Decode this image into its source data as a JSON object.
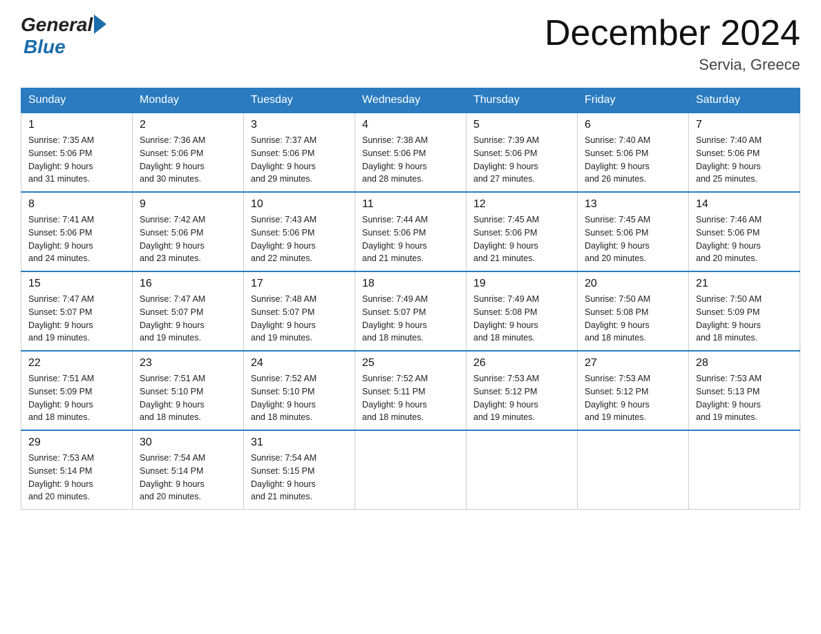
{
  "header": {
    "logo_general": "General",
    "logo_blue": "Blue",
    "month_title": "December 2024",
    "location": "Servia, Greece"
  },
  "days_of_week": [
    "Sunday",
    "Monday",
    "Tuesday",
    "Wednesday",
    "Thursday",
    "Friday",
    "Saturday"
  ],
  "weeks": [
    [
      {
        "day": "1",
        "sunrise": "7:35 AM",
        "sunset": "5:06 PM",
        "daylight": "9 hours and 31 minutes."
      },
      {
        "day": "2",
        "sunrise": "7:36 AM",
        "sunset": "5:06 PM",
        "daylight": "9 hours and 30 minutes."
      },
      {
        "day": "3",
        "sunrise": "7:37 AM",
        "sunset": "5:06 PM",
        "daylight": "9 hours and 29 minutes."
      },
      {
        "day": "4",
        "sunrise": "7:38 AM",
        "sunset": "5:06 PM",
        "daylight": "9 hours and 28 minutes."
      },
      {
        "day": "5",
        "sunrise": "7:39 AM",
        "sunset": "5:06 PM",
        "daylight": "9 hours and 27 minutes."
      },
      {
        "day": "6",
        "sunrise": "7:40 AM",
        "sunset": "5:06 PM",
        "daylight": "9 hours and 26 minutes."
      },
      {
        "day": "7",
        "sunrise": "7:40 AM",
        "sunset": "5:06 PM",
        "daylight": "9 hours and 25 minutes."
      }
    ],
    [
      {
        "day": "8",
        "sunrise": "7:41 AM",
        "sunset": "5:06 PM",
        "daylight": "9 hours and 24 minutes."
      },
      {
        "day": "9",
        "sunrise": "7:42 AM",
        "sunset": "5:06 PM",
        "daylight": "9 hours and 23 minutes."
      },
      {
        "day": "10",
        "sunrise": "7:43 AM",
        "sunset": "5:06 PM",
        "daylight": "9 hours and 22 minutes."
      },
      {
        "day": "11",
        "sunrise": "7:44 AM",
        "sunset": "5:06 PM",
        "daylight": "9 hours and 21 minutes."
      },
      {
        "day": "12",
        "sunrise": "7:45 AM",
        "sunset": "5:06 PM",
        "daylight": "9 hours and 21 minutes."
      },
      {
        "day": "13",
        "sunrise": "7:45 AM",
        "sunset": "5:06 PM",
        "daylight": "9 hours and 20 minutes."
      },
      {
        "day": "14",
        "sunrise": "7:46 AM",
        "sunset": "5:06 PM",
        "daylight": "9 hours and 20 minutes."
      }
    ],
    [
      {
        "day": "15",
        "sunrise": "7:47 AM",
        "sunset": "5:07 PM",
        "daylight": "9 hours and 19 minutes."
      },
      {
        "day": "16",
        "sunrise": "7:47 AM",
        "sunset": "5:07 PM",
        "daylight": "9 hours and 19 minutes."
      },
      {
        "day": "17",
        "sunrise": "7:48 AM",
        "sunset": "5:07 PM",
        "daylight": "9 hours and 19 minutes."
      },
      {
        "day": "18",
        "sunrise": "7:49 AM",
        "sunset": "5:07 PM",
        "daylight": "9 hours and 18 minutes."
      },
      {
        "day": "19",
        "sunrise": "7:49 AM",
        "sunset": "5:08 PM",
        "daylight": "9 hours and 18 minutes."
      },
      {
        "day": "20",
        "sunrise": "7:50 AM",
        "sunset": "5:08 PM",
        "daylight": "9 hours and 18 minutes."
      },
      {
        "day": "21",
        "sunrise": "7:50 AM",
        "sunset": "5:09 PM",
        "daylight": "9 hours and 18 minutes."
      }
    ],
    [
      {
        "day": "22",
        "sunrise": "7:51 AM",
        "sunset": "5:09 PM",
        "daylight": "9 hours and 18 minutes."
      },
      {
        "day": "23",
        "sunrise": "7:51 AM",
        "sunset": "5:10 PM",
        "daylight": "9 hours and 18 minutes."
      },
      {
        "day": "24",
        "sunrise": "7:52 AM",
        "sunset": "5:10 PM",
        "daylight": "9 hours and 18 minutes."
      },
      {
        "day": "25",
        "sunrise": "7:52 AM",
        "sunset": "5:11 PM",
        "daylight": "9 hours and 18 minutes."
      },
      {
        "day": "26",
        "sunrise": "7:53 AM",
        "sunset": "5:12 PM",
        "daylight": "9 hours and 19 minutes."
      },
      {
        "day": "27",
        "sunrise": "7:53 AM",
        "sunset": "5:12 PM",
        "daylight": "9 hours and 19 minutes."
      },
      {
        "day": "28",
        "sunrise": "7:53 AM",
        "sunset": "5:13 PM",
        "daylight": "9 hours and 19 minutes."
      }
    ],
    [
      {
        "day": "29",
        "sunrise": "7:53 AM",
        "sunset": "5:14 PM",
        "daylight": "9 hours and 20 minutes."
      },
      {
        "day": "30",
        "sunrise": "7:54 AM",
        "sunset": "5:14 PM",
        "daylight": "9 hours and 20 minutes."
      },
      {
        "day": "31",
        "sunrise": "7:54 AM",
        "sunset": "5:15 PM",
        "daylight": "9 hours and 21 minutes."
      },
      null,
      null,
      null,
      null
    ]
  ],
  "labels": {
    "sunrise": "Sunrise:",
    "sunset": "Sunset:",
    "daylight": "Daylight:"
  }
}
